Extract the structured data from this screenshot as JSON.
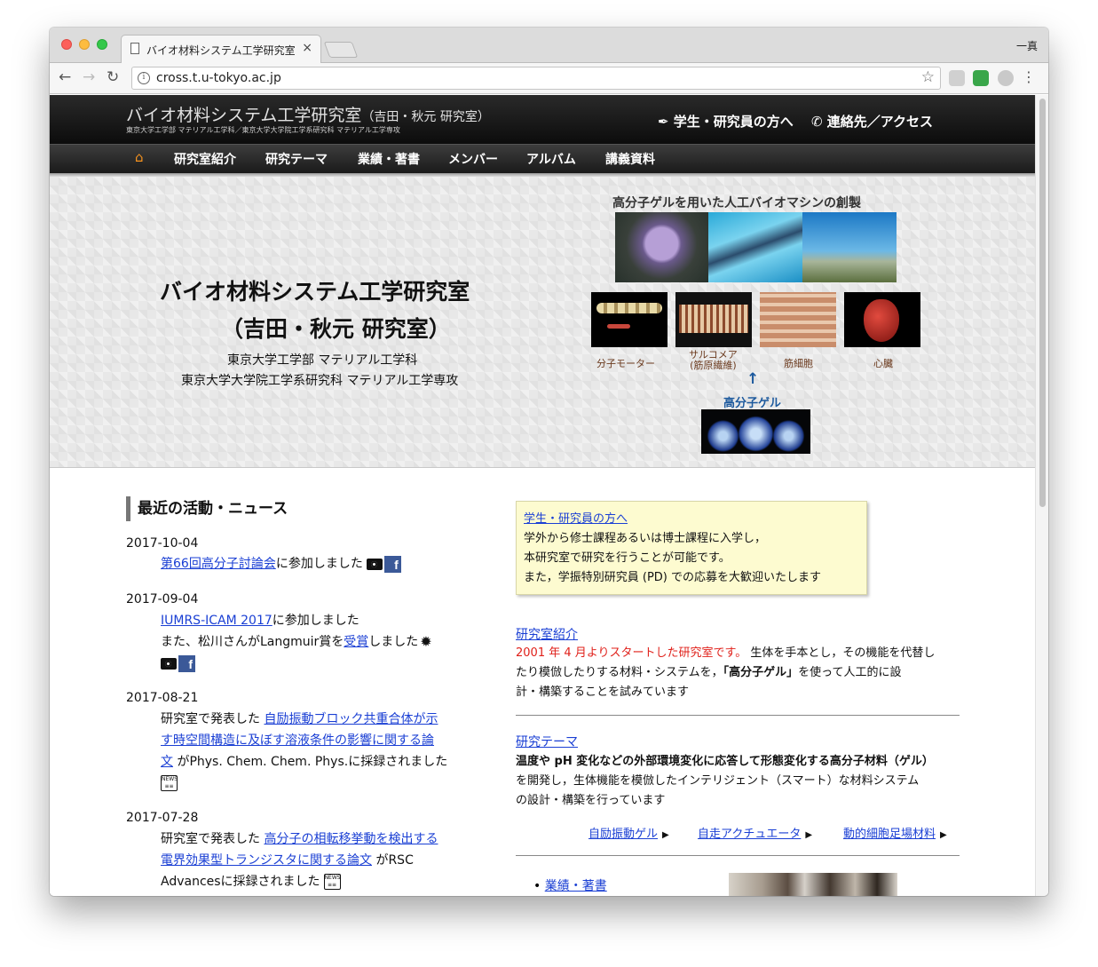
{
  "browser": {
    "tab_title": "バイオ材料システム工学研究室",
    "profile_name": "一真",
    "url": "cross.t.u-tokyo.ac.jp"
  },
  "header": {
    "title": "バイオ材料システム工学研究室",
    "title_suffix": "（吉田・秋元 研究室）",
    "subtitle": "東京大学工学部 マテリアル工学科／東京大学大学院工学系研究科 マテリアル工学専攻",
    "link_students": "学生・研究員の方へ",
    "link_contact": "連絡先／アクセス"
  },
  "nav": {
    "items": [
      "研究室紹介",
      "研究テーマ",
      "業績・著書",
      "メンバー",
      "アルバム",
      "講義資料"
    ]
  },
  "hero": {
    "title_line1": "バイオ材料システム工学研究室",
    "title_line2": "（吉田・秋元 研究室）",
    "dept1": "東京大学工学部 マテリアル工学科",
    "dept2": "東京大学大学院工学系研究科 マテリアル工学専攻",
    "figure_title": "高分子ゲルを用いた人工バイオマシンの創製",
    "labels": {
      "motor": "分子モーター",
      "sarcomere_1": "サルコメア",
      "sarcomere_2": "(筋原繊維)",
      "muscle_cell": "筋細胞",
      "heart": "心臓",
      "gel": "高分子ゲル"
    }
  },
  "news": {
    "heading": "最近の活動・ニュース",
    "items": [
      {
        "date": "2017-10-04",
        "link": "第66回高分子討論会",
        "text": "に参加しました"
      },
      {
        "date": "2017-09-04",
        "link": "IUMRS-ICAM 2017",
        "text": "に参加しました",
        "line2_pre": "また、松川さんがLangmuir賞を",
        "line2_link": "受賞",
        "line2_post": "しました"
      },
      {
        "date": "2017-08-21",
        "pre": "研究室で発表した",
        "link_l1": "自励振動ブロック共重合体が示",
        "link_l2": "す時空間構造に及ぼす溶液条件の影響に関する論",
        "link_l3": "文",
        "post": "がPhys. Chem. Chem. Phys.に採録されました"
      },
      {
        "date": "2017-07-28",
        "pre": "研究室で発表した",
        "link_l1": "高分子の相転移挙動を検出する",
        "link_l2": "電界効果型トランジスタに関する論文",
        "post_l2": "がRSC",
        "post_l3": "Advancesに採録されました"
      }
    ]
  },
  "notice": {
    "link": "学生・研究員の方へ",
    "line1": "学外から修士課程あるいは博士課程に入学し，",
    "line2": "本研究室で研究を行うことが可能です。",
    "line3": "また，学振特別研究員 (PD) での応募を大歓迎いたします"
  },
  "intro": {
    "link": "研究室紹介",
    "red_text": "2001 年 4 月よりスタートした研究室です。",
    "text1": " 生体を手本とし，その機能を代替し",
    "text2": "たり模倣したりする材料・システムを，",
    "bold": "「高分子ゲル」",
    "text3": "を使って人工的に設",
    "text4": "計・構築することを試みています"
  },
  "theme": {
    "link": "研究テーマ",
    "bold": "温度や pH 変化などの外部環境変化に応答して形態変化する高分子材料（ゲル）",
    "text1": "を開発し，生体機能を模倣したインテリジェント（スマート）な材料システム",
    "text2": "の設計・構築を行っています",
    "sublinks": [
      "自励振動ゲル",
      "自走アクチュエータ",
      "動的細胞足場材料"
    ]
  },
  "publications": {
    "link": "業績・著書"
  }
}
